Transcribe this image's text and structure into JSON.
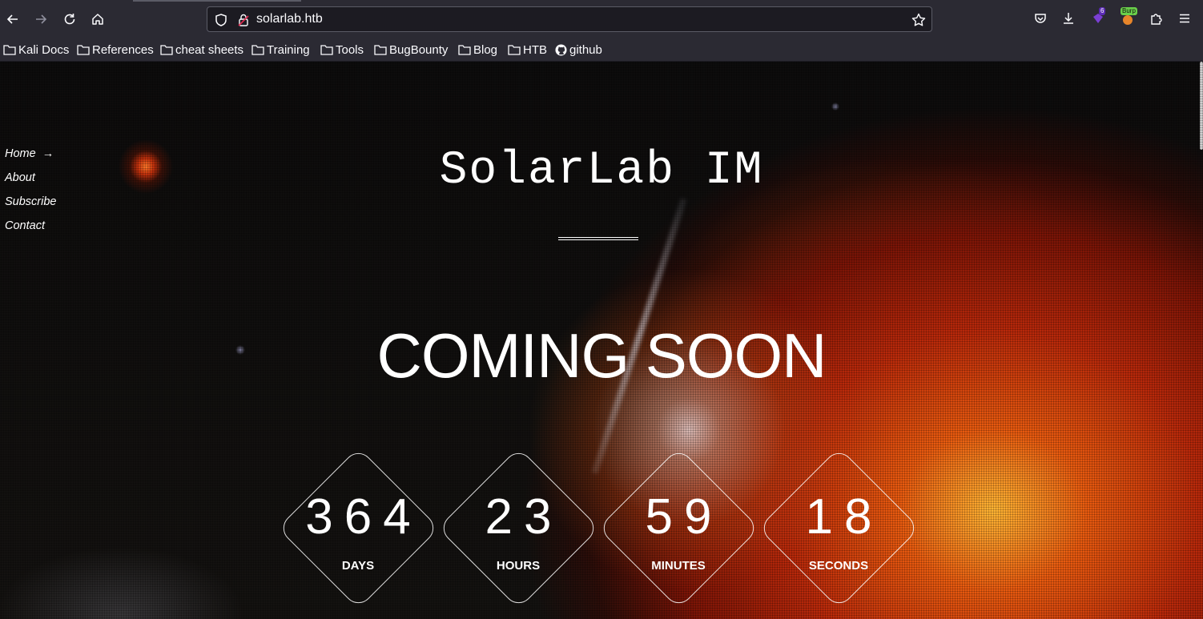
{
  "browser": {
    "url": "solarlab.htb",
    "extension_badge_count": "6",
    "burp_label": "Burp"
  },
  "bookmarks": [
    "Kali Docs",
    "References",
    "cheat sheets",
    "Training",
    "Tools",
    "BugBounty",
    "Blog",
    "HTB",
    "github"
  ],
  "site": {
    "title": "SolarLab IM",
    "headline": "COMING SOON",
    "menu": [
      "Home",
      "About",
      "Subscribe",
      "Contact"
    ],
    "menu_active_arrow": "→"
  },
  "countdown": [
    {
      "value": "364",
      "label": "DAYS"
    },
    {
      "value": "23",
      "label": "HOURS"
    },
    {
      "value": "59",
      "label": "MINUTES"
    },
    {
      "value": "18",
      "label": "SECONDS"
    }
  ],
  "colors": {
    "chrome_bg": "#2b2a33",
    "url_bg": "#1c1b22",
    "text": "#ffffff"
  },
  "icons": {
    "back": "arrow-left-icon",
    "forward": "arrow-right-icon",
    "reload": "reload-icon",
    "home": "home-icon",
    "shield": "shield-icon",
    "lock": "lock-icon",
    "star": "star-icon",
    "pocket": "pocket-icon",
    "download": "download-icon",
    "extensions": "puzzle-icon",
    "menu": "hamburger-icon",
    "folder": "folder-icon",
    "github": "github-icon"
  }
}
